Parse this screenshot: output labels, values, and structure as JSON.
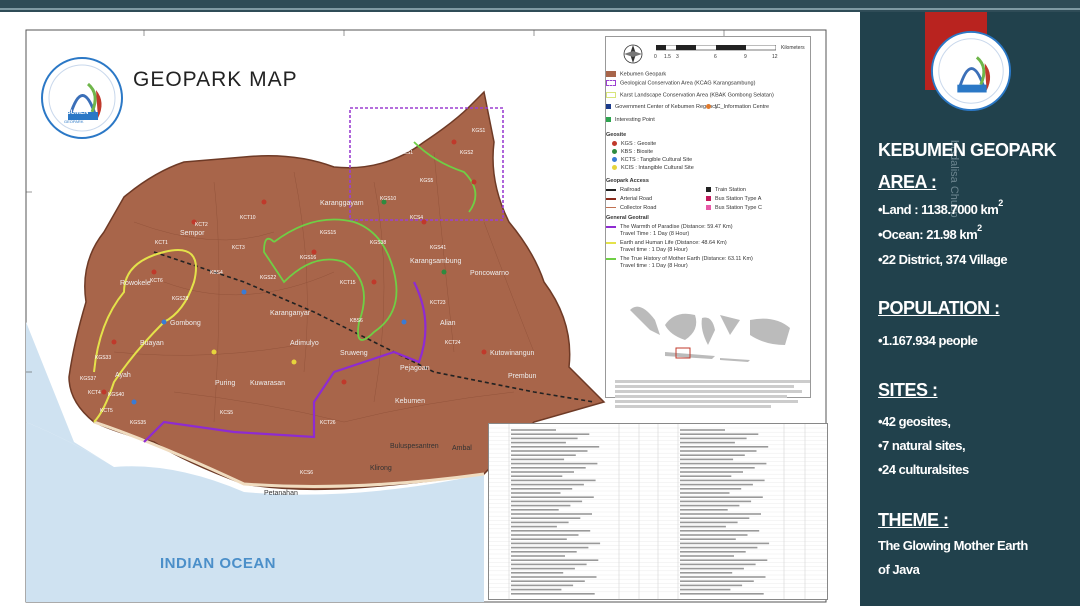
{
  "map": {
    "title": "GEOPARK MAP",
    "ocean_label": "INDIAN OCEAN",
    "logo_text": "KEBUMEN",
    "logo_subtext": "GEOPARK",
    "place_labels": [
      "Karangsambung",
      "Ayah",
      "Pejagoan",
      "Petanahan",
      "Buluspesantren",
      "Klirong",
      "Ambal",
      "Kebumen",
      "Prembun",
      "Kutowinangun",
      "Puring",
      "Rowokele",
      "Sempor",
      "Karanggayam",
      "Alian",
      "Poncowarno",
      "Sruweng",
      "Adimulyo",
      "Gombong",
      "Buayan",
      "Kuwarasan",
      "Karanganyar"
    ],
    "geosite_codes": [
      "KGS1",
      "KGS2",
      "KGS5",
      "KGS10",
      "KGS15",
      "KGS16",
      "KGS22",
      "KGS28",
      "KGS33",
      "KGS37",
      "KCT1",
      "KCT2",
      "KCT3",
      "KCT4",
      "KCT5",
      "KCT6",
      "KCT10",
      "KCT15",
      "KCT23",
      "KCT24",
      "KCT26",
      "KCS1",
      "KCS4",
      "KGS41",
      "KGS38",
      "KBS4",
      "KBS6",
      "KCS5",
      "KCS6",
      "KGS40",
      "KGS35"
    ]
  },
  "legend": {
    "scale_unit": "Kilometers",
    "scale_ticks": [
      "0",
      "1.5",
      "3",
      "6",
      "9",
      "12"
    ],
    "items": [
      {
        "label": "Kebumen Geopark",
        "color": "#a8654a"
      },
      {
        "label": "Geological Conservation Area (KCAG Karangsambung)",
        "color": "#9b3fd1"
      },
      {
        "label": "Karst Landscape Conservation Area (KBAK Gombong Selatan)",
        "color": "#d8e57a"
      },
      {
        "label": "Government Center of Kebumen Regency",
        "color": "#1a3a8a"
      },
      {
        "label": "IC_Information Centre",
        "color": "#e07a2d"
      },
      {
        "label": "Interesting Point",
        "color": "#2ea44f"
      }
    ],
    "geosite_header": "Geosite",
    "geosite_items": [
      {
        "label": "KGS : Geosite",
        "color": "#c0392b"
      },
      {
        "label": "KBS : Biosite",
        "color": "#2e8b3f"
      },
      {
        "label": "KCTS : Tangible Cultural Site",
        "color": "#3a7bd5"
      },
      {
        "label": "KCIS : Intangible Cultural Site",
        "color": "#e6d43c"
      }
    ],
    "access_header": "Geopark Access",
    "access_items": [
      "Railroad",
      "Arterial Road",
      "Collector Road",
      "Train Station",
      "Bus Station Type A",
      "Bus Station Type C"
    ],
    "geotrail_header": "General Geotrail",
    "geotrail_items": [
      {
        "label": "The Warmth of Paradise (Distance: 59.47 Km)",
        "sub": "Travel Time : 1 Day (8 Hour)",
        "color": "#8e2bd1"
      },
      {
        "label": "Earth and Human Life (Distance: 48.64 Km)",
        "sub": "Travel time : 1 Day (8 Hour)",
        "color": "#e4e24a"
      },
      {
        "label": "The True History of Mother Earth (Distance: 63.11 Km)",
        "sub": "Travel time : 1 Day (8 Hour)",
        "color": "#6fcf45"
      }
    ]
  },
  "sidebar": {
    "title": "KEBUMEN GEOPARK",
    "area_heading": "AREA :",
    "land": "•Land   : 1138.7000 km",
    "land_sup": "2",
    "ocean": "•Ocean: 21.98 km",
    "ocean_sup": "2",
    "districts": "•22 District, 374 Village",
    "population_heading": "POPULATION :",
    "population": "•1.167.934 people",
    "sites_heading": "SITES :",
    "sites": [
      "•42 geosites,",
      "•7 natural sites,",
      "•24 culturalsites"
    ],
    "theme_heading": "THEME :",
    "theme_line1": "The Glowing Mother Earth",
    "theme_line2": "of Java",
    "watermark": "bisdalisa Chusp"
  },
  "colors": {
    "sidebar_bg": "#21414c",
    "land": "#a8654a",
    "sea": "#cfe2f1",
    "accent_red": "#b9231f"
  }
}
